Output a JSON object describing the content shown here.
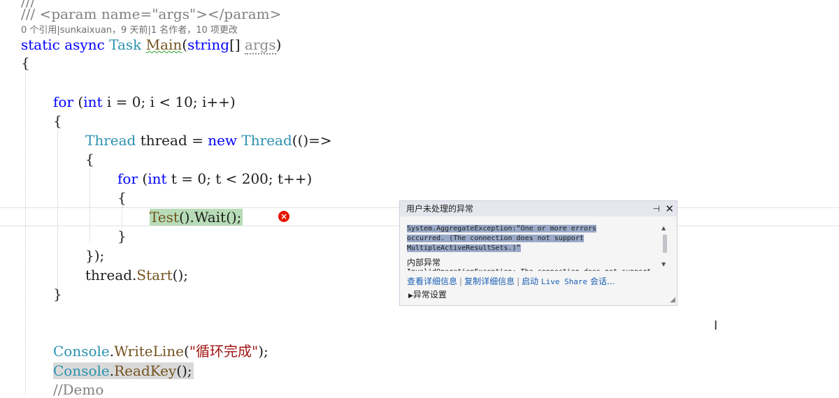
{
  "code": {
    "line_top_cut": "///",
    "line_param": "/// <param name=\"args\"></param>",
    "codelens": "0 个引用|sunkaixuan，9 天前|1 名作者，10 项更改",
    "static_kw": "static",
    "async_kw": "async",
    "task_type": "Task",
    "main_fn": "Main",
    "main_open": "(",
    "string_kw": "string",
    "arr": "[] ",
    "args_param": "args",
    "main_close": ")",
    "brace_open": "{",
    "for_kw": "for",
    "for1_open": " (",
    "int_kw": "int",
    "for1_rest": " i = 0; i < 10; i++)",
    "brace_open2": "{",
    "thread_type": "Thread",
    "thread_var": " thread = ",
    "new_kw": "new",
    "thread_type2": "Thread",
    "thread_lambda": "(()=>",
    "brace_open3": "{",
    "for2_kw": "for",
    "for2_open": " (",
    "int2_kw": "int",
    "for2_rest": " t = 0; t < 200; t++)",
    "brace_open4": "{",
    "test_call": "Test",
    "wait_call": "().Wait();",
    "brace_close4": "}",
    "thread_end": "});",
    "start_obj": "thread.",
    "start_fn": "Start",
    "start_end": "();",
    "brace_close2": "}",
    "console_type": "Console",
    "dot": ".",
    "writeline_fn": "WriteLine",
    "writeline_open": "(",
    "writeline_str": "\"循环完成\"",
    "writeline_close": ");",
    "console_type2": "Console",
    "dot2": ".",
    "readkey_fn": "ReadKey",
    "readkey_end": "();",
    "demo_comment": "//Demo"
  },
  "exception_popup": {
    "title": "用户未处理的异常",
    "pin_icon": "pin-icon",
    "close_icon": "close-icon",
    "message_line1": "System.AggregateException:“One or more errors",
    "message_line2": "occurred. (The connection does not support",
    "message_line3": "MultipleActiveResultSets.)”",
    "inner_label": "内部异常",
    "inner_cut": "InvalidOperationException: The connection does not support",
    "link_view_details": "查看详细信息",
    "link_copy_details": "复制详细信息",
    "link_live_share_prefix": "启动 ",
    "link_live_share_mono": "Live Share",
    "link_live_share_suffix": " 会话...",
    "settings_label": "异常设置"
  },
  "colors": {
    "keyword": "#0000ff",
    "type": "#2b91af",
    "method": "#74531f",
    "comment": "#808080",
    "string": "#a31515",
    "error": "#e51400",
    "highlight_current": "#b7dcb7",
    "highlight_ref": "#d9d9d9"
  }
}
